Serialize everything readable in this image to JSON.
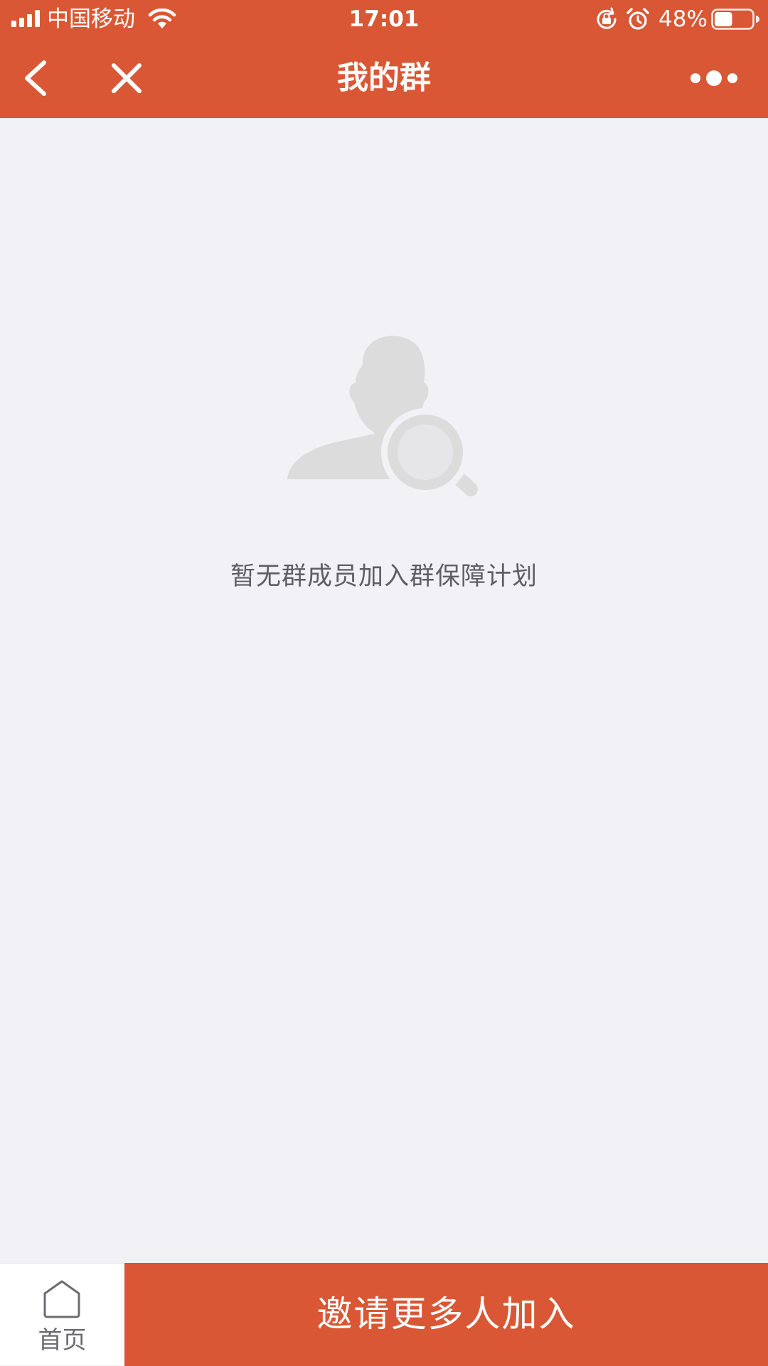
{
  "status_bar": {
    "carrier": "中国移动",
    "time": "17:01",
    "battery_percent": "48%",
    "battery_level": 0.48,
    "icons": [
      "signal-icon",
      "wifi-icon",
      "rotation-lock-icon",
      "alarm-icon",
      "battery-icon"
    ]
  },
  "nav": {
    "title": "我的群",
    "icons": [
      "back-arrow-icon",
      "close-icon",
      "more-icon"
    ]
  },
  "empty_state": {
    "message": "暂无群成员加入群保障计划",
    "icon": "user-search-icon"
  },
  "bottom_bar": {
    "home_label": "首页",
    "home_icon": "home-icon",
    "invite_label": "邀请更多人加入"
  },
  "colors": {
    "brand": "#d95734",
    "background": "#f2f1f6",
    "illustration": "#dcdcdc"
  }
}
